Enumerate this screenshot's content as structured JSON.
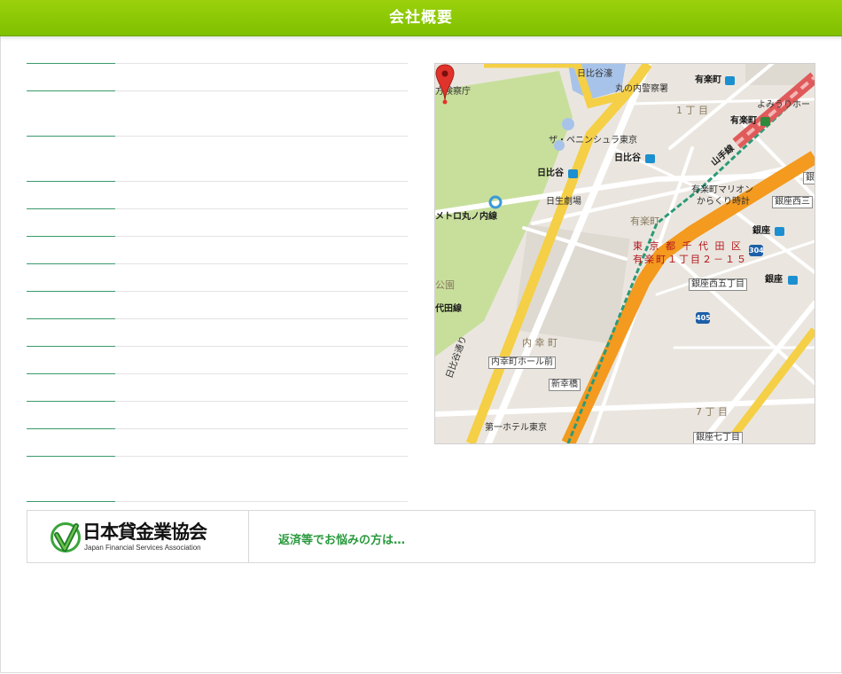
{
  "header": {
    "title": "会社概要"
  },
  "company_table": {
    "rows": [
      {
        "label": "",
        "value": ""
      },
      {
        "label": "",
        "value": ""
      },
      {
        "label": "",
        "value": ""
      },
      {
        "label": "",
        "value": ""
      },
      {
        "label": "",
        "value": ""
      },
      {
        "label": "",
        "value": ""
      },
      {
        "label": "",
        "value": ""
      },
      {
        "label": "",
        "value": ""
      },
      {
        "label": "",
        "value": ""
      },
      {
        "label": "",
        "value": ""
      },
      {
        "label": "",
        "value": ""
      },
      {
        "label": "",
        "value": ""
      },
      {
        "label": "",
        "value": ""
      },
      {
        "label": "",
        "value": ""
      },
      {
        "label": "",
        "value": ""
      }
    ]
  },
  "map": {
    "address_line1": "東 京 都 千 代 田 区",
    "address_line2": "有楽町１丁目２－１５",
    "labels": {
      "hibiya_moat": "日比谷濠",
      "marunouchi_police": "丸の内警察署",
      "yurakucho_top": "有楽町",
      "yomiuri_hall": "よみうりホー",
      "public_prosecutors": "方検察庁",
      "itchome_top": "1 丁 目",
      "yurakucho_jr": "有楽町",
      "peninsula": "ザ・ペニンシュラ東京",
      "hibiya_left": "日比谷",
      "hibiya_right": "日比谷",
      "yamanote": "山手線",
      "yurakucho_marion": "有楽町マリオン",
      "karakuri_clock": "からくり時計",
      "nissay_theater": "日生劇場",
      "yurakucho_area": "有楽町",
      "ginza_west3": "銀座西三",
      "metro_marunouchi": "メトロ丸ノ内線",
      "ginza_station": "銀座",
      "ginza_station2": "銀座",
      "route_304": "304",
      "park": "公園",
      "chiyoda_line": "代田線",
      "ginza_west5": "銀座西五丁目",
      "route_405": "405",
      "uchisaiwaicho": "内 幸 町",
      "uchisaiwaicho_hall": "内幸町ホール前",
      "hibiya_dori": "日比谷通り",
      "shinsaiwaibashi": "新幸橋",
      "seven_chome": "7 丁 目",
      "daiichi_hotel": "第一ホテル東京",
      "ginza_seven": "銀座七丁目",
      "ginza_edge": "銀"
    },
    "colors": {
      "highway": "#f39a1f",
      "major_road": "#f5cf45",
      "park": "#c8df9c",
      "water": "#a7c3e9",
      "rail_jr": "#e05a5a",
      "rail_line": "#2a9a78",
      "land": "#eae6df",
      "road": "#ffffff",
      "pin": "#e0332b"
    }
  },
  "banner": {
    "org_name": "日本貸金業協会",
    "org_name_en": "Japan Financial Services Association",
    "link_text": "返済等でお悩みの方は…"
  }
}
